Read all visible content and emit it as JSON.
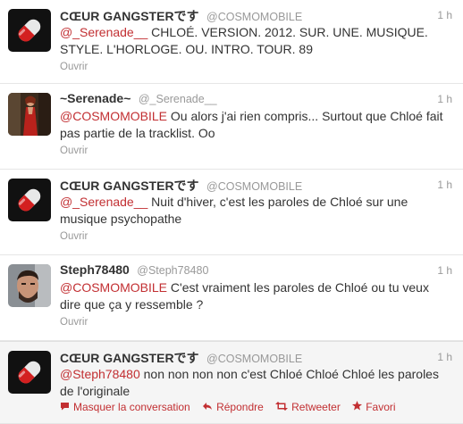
{
  "tweets": [
    {
      "fullname": "CŒUR GANGSTERです",
      "username": "@COSMOMOBILE",
      "time": "1 h",
      "mention": "@_Serenade__",
      "text": " CHLOÉ. VERSION. 2012. SUR. UNE. MUSIQUE. STYLE. L'HORLOGE. OU. INTRO. TOUR. 89",
      "open_label": "Ouvrir",
      "avatar_icon": "capsule-avatar"
    },
    {
      "fullname": "~Serenade~",
      "username": "@_Serenade__",
      "time": "1 h",
      "mention": "@COSMOMOBILE",
      "text": " Ou alors j'ai rien compris... Surtout que Chloé fait pas partie de la tracklist. Oo",
      "open_label": "Ouvrir",
      "avatar_icon": "woman-red-dress-avatar"
    },
    {
      "fullname": "CŒUR GANGSTERです",
      "username": "@COSMOMOBILE",
      "time": "1 h",
      "mention": "@_Serenade__",
      "text": " Nuit d'hiver, c'est les paroles de Chloé sur une musique psychopathe",
      "open_label": "Ouvrir",
      "avatar_icon": "capsule-avatar"
    },
    {
      "fullname": "Steph78480",
      "username": "@Steph78480",
      "time": "1 h",
      "mention": "@COSMOMOBILE",
      "text": " C'est vraiment les paroles de Chloé ou tu veux dire que ça y ressemble ?",
      "open_label": "Ouvrir",
      "avatar_icon": "man-portrait-avatar"
    },
    {
      "fullname": "CŒUR GANGSTERです",
      "username": "@COSMOMOBILE",
      "time": "1 h",
      "mention": "@Steph78480",
      "text": " non non non non c'est Chloé Chloé Chloé les paroles de l'originale",
      "avatar_icon": "capsule-avatar",
      "actions": {
        "hide_conversation": "Masquer la conversation",
        "reply": "Répondre",
        "retweet": "Retweeter",
        "favorite": "Favori"
      }
    }
  ],
  "colors": {
    "link": "#c22f32",
    "muted": "#999999",
    "text": "#333333"
  }
}
